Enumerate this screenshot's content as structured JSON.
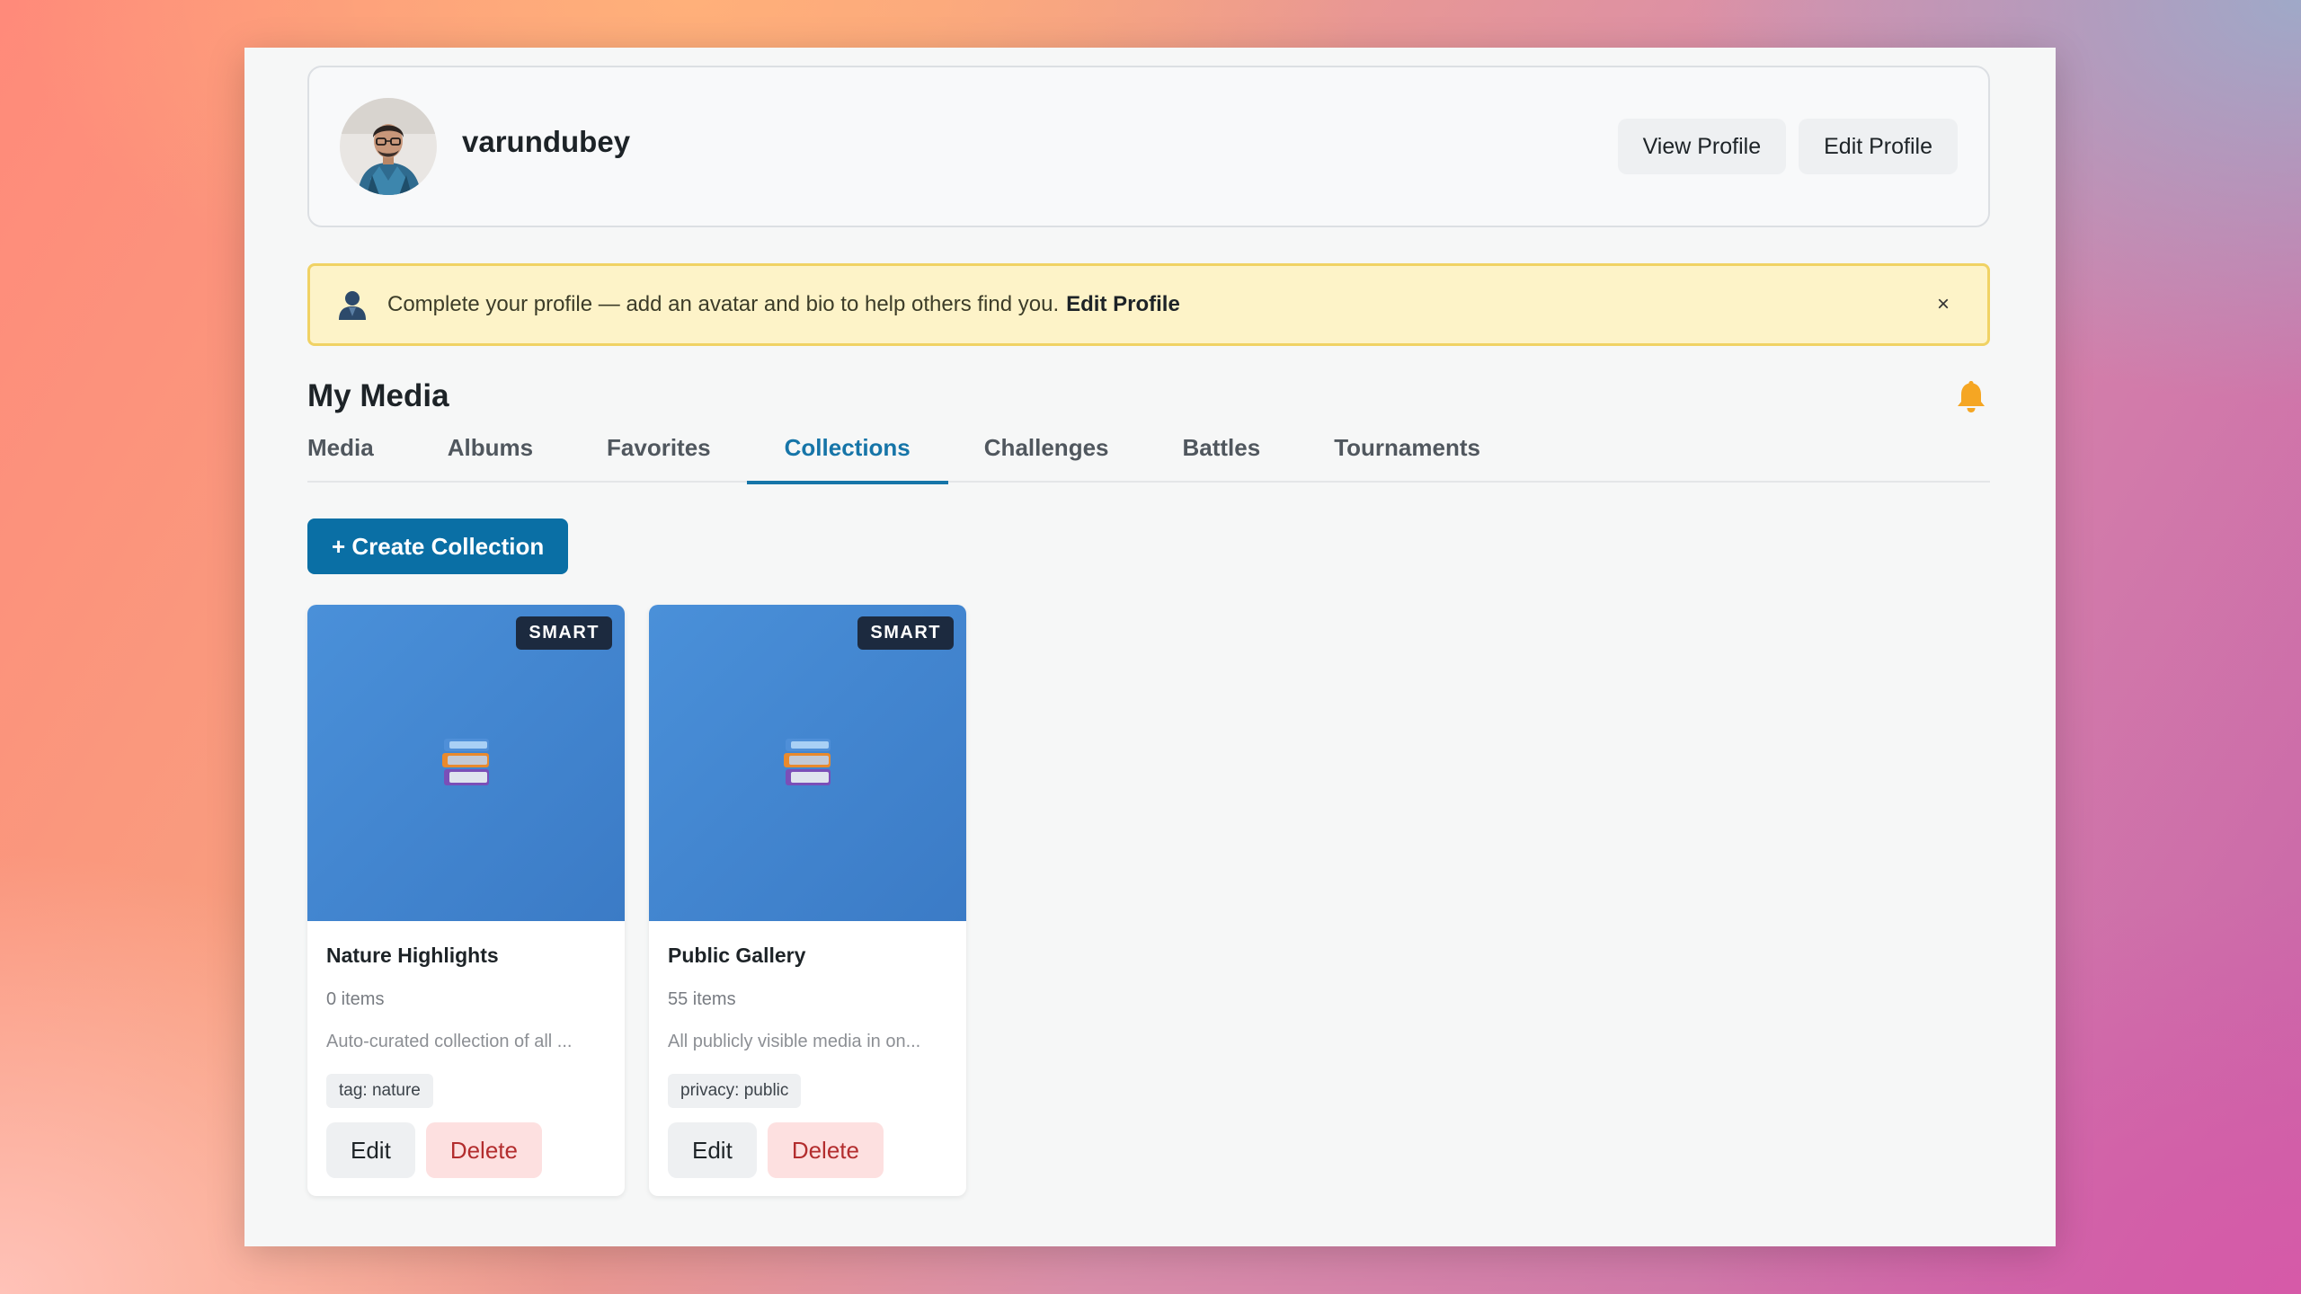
{
  "profile": {
    "username": "varundubey",
    "avatar_alt": "user avatar",
    "view_profile_label": "View Profile",
    "edit_profile_label": "Edit Profile"
  },
  "notice": {
    "icon": "user-icon",
    "text": "Complete your profile — add an avatar and bio to help others find you.",
    "link_label": "Edit Profile",
    "close_label": "×"
  },
  "media": {
    "title": "My Media",
    "bell_icon": "bell-icon",
    "tabs": [
      {
        "label": "Media"
      },
      {
        "label": "Albums"
      },
      {
        "label": "Favorites"
      },
      {
        "label": "Collections",
        "active": true
      },
      {
        "label": "Challenges"
      },
      {
        "label": "Battles"
      },
      {
        "label": "Tournaments"
      }
    ],
    "create_label": "+ Create Collection"
  },
  "collections": [
    {
      "badge": "SMART",
      "title": "Nature Highlights",
      "count": "0 items",
      "description": "Auto-curated collection of all ...",
      "tag": "tag: nature",
      "edit_label": "Edit",
      "delete_label": "Delete"
    },
    {
      "badge": "SMART",
      "title": "Public Gallery",
      "count": "55 items",
      "description": "All publicly visible media in on...",
      "tag": "privacy: public",
      "edit_label": "Edit",
      "delete_label": "Delete"
    }
  ],
  "colors": {
    "accent": "#1675a8",
    "primary_button": "#0a6fa5",
    "notice_bg": "#fdf3c8",
    "notice_border": "#f0d264",
    "delete_text": "#b32d2e",
    "delete_bg": "#fde0e0",
    "cover": "#4a90d9",
    "badge_bg": "#1c2a3f"
  }
}
